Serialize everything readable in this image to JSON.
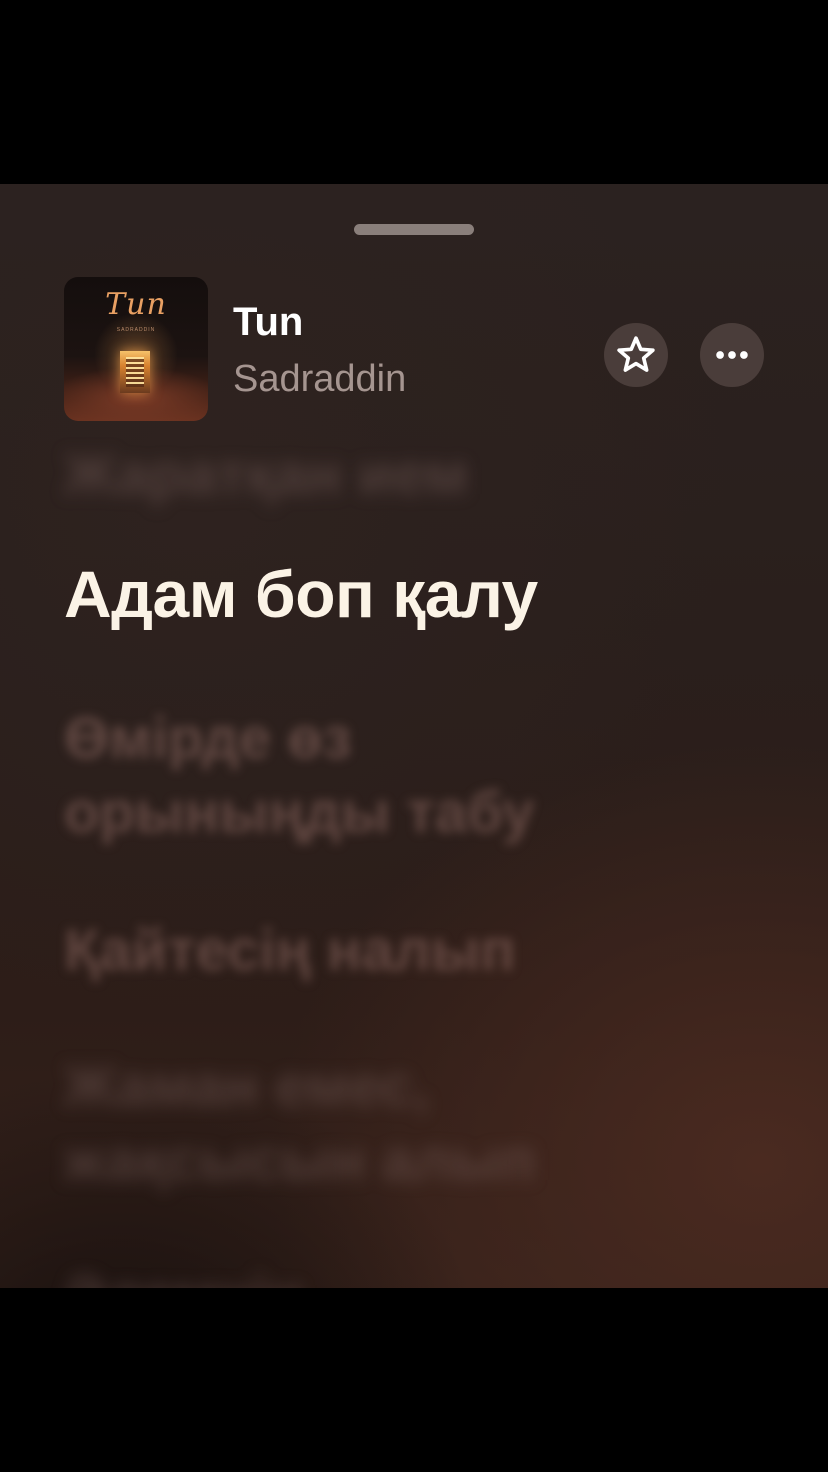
{
  "track": {
    "title": "Tun",
    "artist": "Sadraddin"
  },
  "artwork": {
    "title": "Tun",
    "subtitle": "SADRADDIN"
  },
  "lyrics": {
    "previous": "Жаратқан ием",
    "current": "Адам боп қалу",
    "next": [
      "Өмірде өз",
      "орыныңды табу",
      "Қайтесің налып",
      "Жаман емес,",
      "жақсысын алып",
      "Әлемнің"
    ]
  },
  "icons": {
    "favorite": "star-icon",
    "more": "ellipsis-icon"
  },
  "colors": {
    "accent": "#fbf3e6",
    "artist": "#a59590",
    "button_bg": "#4a3d3a"
  }
}
